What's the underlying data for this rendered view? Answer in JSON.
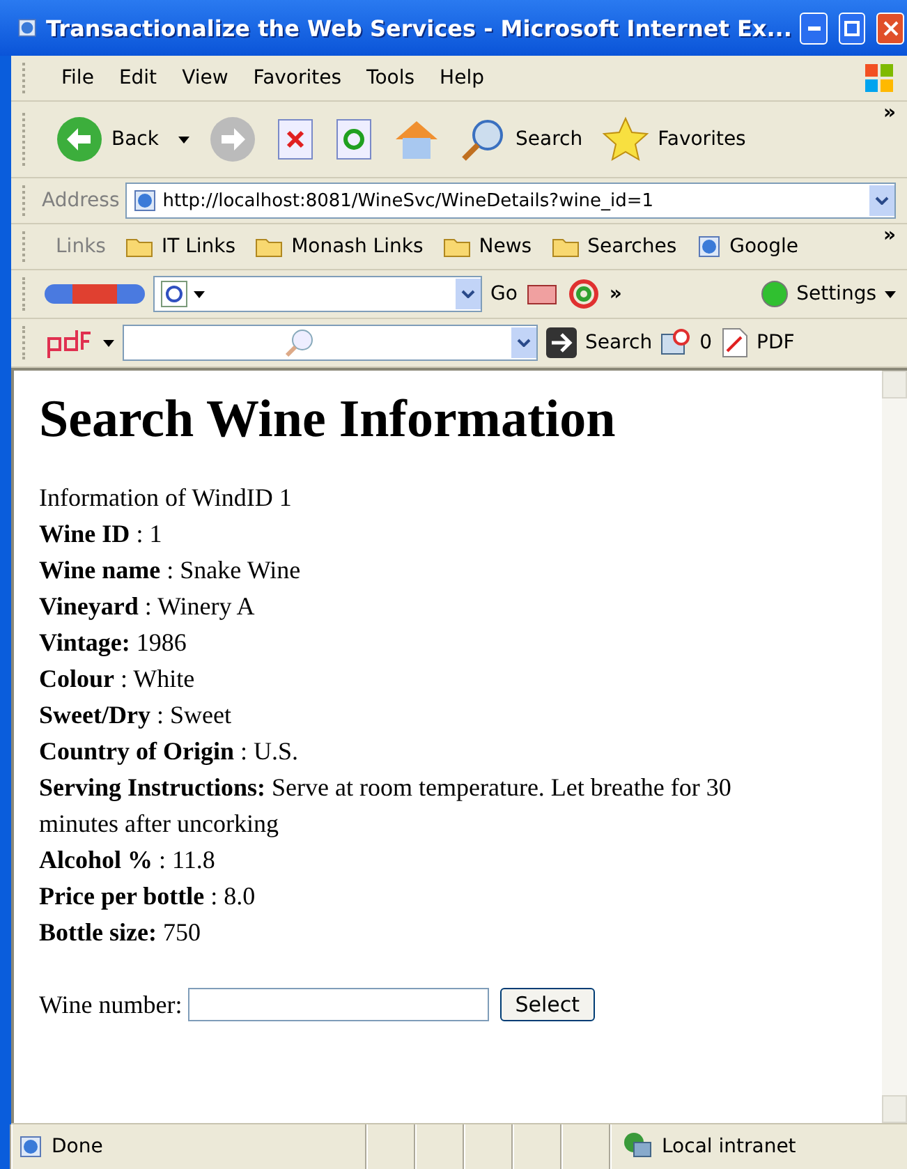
{
  "window": {
    "title": "Transactionalize the Web Services - Microsoft Internet Ex..."
  },
  "menu": [
    "File",
    "Edit",
    "View",
    "Favorites",
    "Tools",
    "Help"
  ],
  "toolbar": {
    "back": "Back",
    "search": "Search",
    "favorites": "Favorites",
    "more": "»"
  },
  "address": {
    "label": "Address",
    "value": "http://localhost:8081/WineSvc/WineDetails?wine_id=1"
  },
  "links": {
    "label": "Links",
    "items": [
      "IT Links",
      "Monash Links",
      "News",
      "Searches",
      "Google"
    ],
    "more": "»"
  },
  "google_bar": {
    "go": "Go",
    "more": "»",
    "settings": "Settings"
  },
  "pdf_bar": {
    "search": "Search",
    "count": "0",
    "pdf": "PDF"
  },
  "page": {
    "heading": "Search Wine Information",
    "intro": "Information of WindID 1",
    "details": [
      "**Wine ID** : 1",
      "**Wine name** : Snake Wine",
      "**Vineyard** : Winery A",
      "**Vintage:** 1986",
      "**Colour** : White",
      "**Sweet/Dry** : Sweet",
      "**Country of Origin** : U.S.",
      "**Serving Instructions:** Serve at room temperature. Let breathe for 30 minutes after uncorking",
      "**Alcohol %** : 11.8",
      "**Price per bottle** : 8.0",
      "**Bottle size:** 750"
    ],
    "form": {
      "label": "Wine number:",
      "button": "Select"
    }
  },
  "status_bar": {
    "status": "Done",
    "zone": "Local intranet"
  }
}
